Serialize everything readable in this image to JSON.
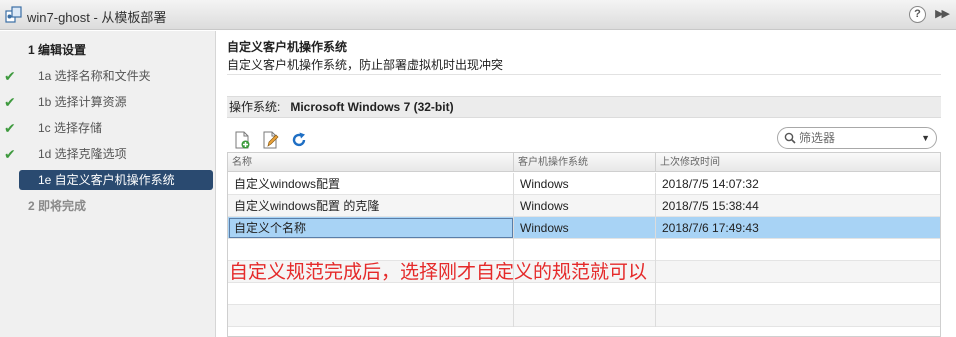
{
  "window": {
    "title": "win7-ghost - 从模板部署",
    "help_label": "?",
    "collapse_label": "▶▶"
  },
  "steps": [
    {
      "label": "1  编辑设置",
      "kind": "main",
      "done": false,
      "active": false
    },
    {
      "label": "1a  选择名称和文件夹",
      "kind": "sub",
      "done": true,
      "active": false
    },
    {
      "label": "1b  选择计算资源",
      "kind": "sub",
      "done": true,
      "active": false
    },
    {
      "label": "1c  选择存储",
      "kind": "sub",
      "done": true,
      "active": false
    },
    {
      "label": "1d  选择克隆选项",
      "kind": "sub",
      "done": true,
      "active": false
    },
    {
      "label": "1e  自定义客户机操作系统",
      "kind": "sub",
      "done": false,
      "active": true
    },
    {
      "label": "2  即将完成",
      "kind": "main",
      "done": false,
      "active": false
    }
  ],
  "check_glyph": "✔",
  "main": {
    "heading": "自定义客户机操作系统",
    "description": "自定义客户机操作系统，防止部署虚拟机时出现冲突",
    "os_label": "操作系统:",
    "os_value": "Microsoft Windows 7 (32-bit)",
    "filter_placeholder": "筛选器",
    "dropdown_glyph": "▼"
  },
  "table": {
    "columns": [
      "名称",
      "客户机操作系统",
      "上次修改时间"
    ],
    "rows": [
      {
        "name": "自定义windows配置",
        "os": "Windows",
        "modified": "2018/7/5 14:07:32",
        "selected": false
      },
      {
        "name": "自定义windows配置 的克隆",
        "os": "Windows",
        "modified": "2018/7/5 15:38:44",
        "selected": false
      },
      {
        "name": "自定义个名称",
        "os": "Windows",
        "modified": "2018/7/6 17:49:43",
        "selected": true
      }
    ]
  },
  "annotation": "自定义规范完成后，选择刚才自定义的规范就可以",
  "colors": {
    "active_step": "#2a4a70",
    "selected_row": "#a8d3f5",
    "check": "#3f9a3f",
    "annotation": "#e52a2a"
  }
}
